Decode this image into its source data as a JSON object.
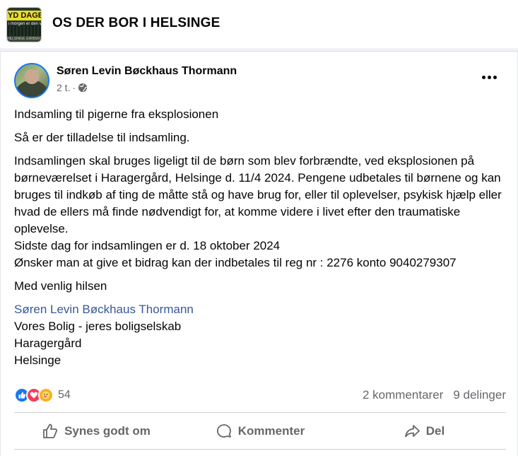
{
  "group": {
    "title": "OS DER BOR I HELSINGE",
    "avatar_line1": "YD DAGEN i DA",
    "avatar_line2": "i morgen er den var",
    "avatar_line3": "HELSINGE    GRIBSKOV"
  },
  "post": {
    "author": "Søren Levin Bøckhaus Thormann",
    "time": "2 t.",
    "separator": "·",
    "privacy_icon": "globe-icon",
    "more_icon": "more-options-icon",
    "paragraphs": {
      "p1": "Indsamling til pigerne fra eksplosionen",
      "p2": "Så er der tilladelse til indsamling.",
      "p3": "Indsamlingen skal bruges ligeligt til de børn som blev forbrændte, ved eksplosionen på børneværelset i Haragergård, Helsinge d. 11/4 2024. Pengene udbetales til børnene og kan bruges til indkøb af ting de måtte stå og have brug for, eller til oplevelser, psykisk hjælp eller hvad de ellers må finde nødvendigt for, at komme videre i livet efter den traumatiske oplevelse.",
      "p4": "Sidste dag for indsamlingen er d. 18 oktober 2024",
      "p5": "Ønsker man at give et bidrag kan der indbetales til reg nr : 2276 konto 9040279307",
      "p6": "Med venlig hilsen",
      "signature_name": "Søren Levin Bøckhaus Thormann",
      "sig2": "Vores Bolig - jeres boligselskab",
      "sig3": "Haragergård",
      "sig4": "Helsinge"
    }
  },
  "stats": {
    "reaction_icons": [
      "like-icon",
      "love-icon",
      "care-icon"
    ],
    "reaction_count": "54",
    "comments": "2 kommentarer",
    "shares": "9 delinger"
  },
  "actions": {
    "like": "Synes godt om",
    "comment": "Kommenter",
    "share": "Del"
  },
  "colors": {
    "link": "#385898",
    "like": "#1877f2",
    "love": "#f33e58",
    "care": "#f7b125",
    "secondary_text": "#65676b"
  }
}
